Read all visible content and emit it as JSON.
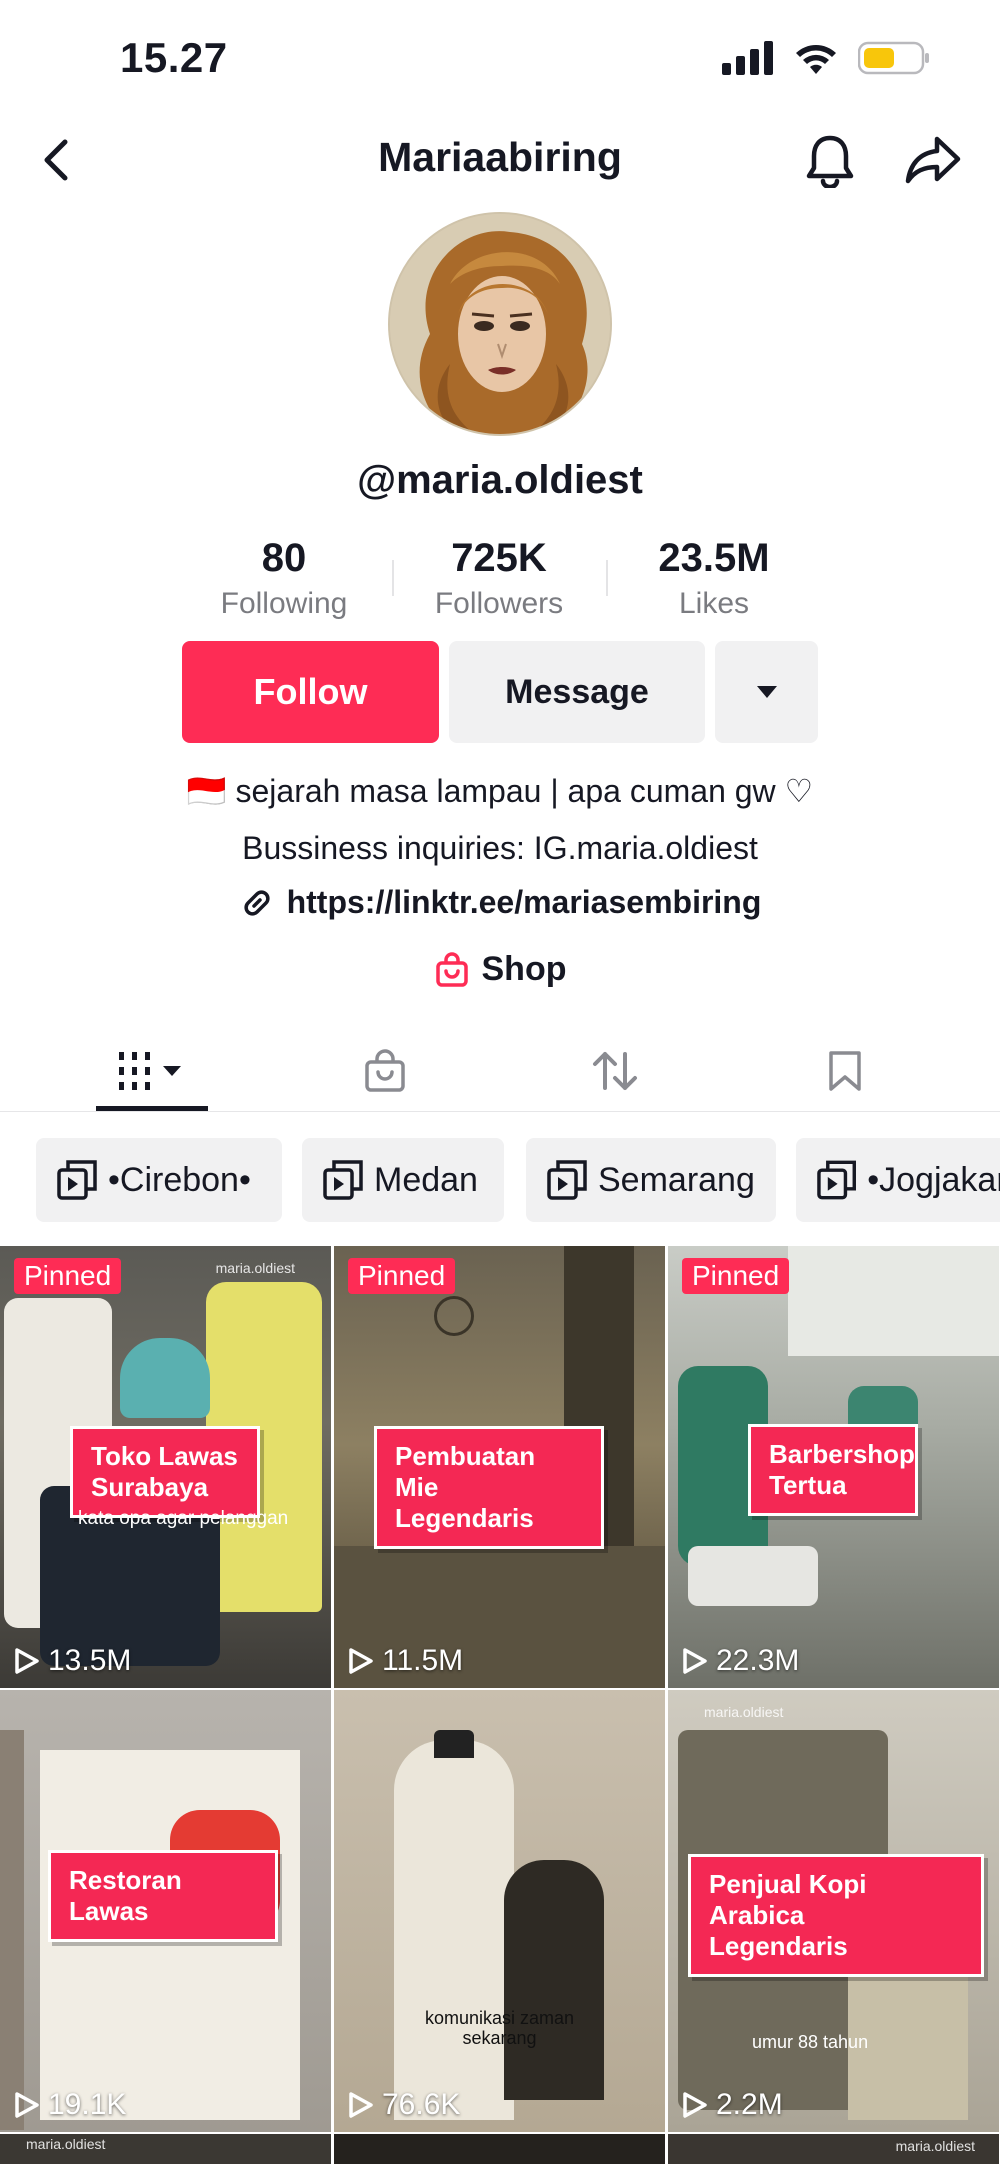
{
  "status_bar": {
    "time": "15.27"
  },
  "header": {
    "title": "Mariaabiring"
  },
  "profile": {
    "username": "@maria.oldiest",
    "stats": [
      {
        "value": "80",
        "label": "Following"
      },
      {
        "value": "725K",
        "label": "Followers"
      },
      {
        "value": "23.5M",
        "label": "Likes"
      }
    ],
    "follow_label": "Follow",
    "message_label": "Message",
    "bio_line1": "🇮🇩 sejarah masa lampau | apa cuman gw ♡",
    "bio_line2": "Bussiness inquiries: IG.maria.oldiest",
    "link": "https://linktr.ee/mariasembiring",
    "shop_label": "Shop"
  },
  "playlists": [
    "•Cirebon•",
    "Medan",
    "Semarang",
    "•Jogjakarta"
  ],
  "videos": [
    {
      "pinned": "Pinned",
      "title_line1": "Toko Lawas",
      "title_line2": "Surabaya",
      "views": "13.5M",
      "caption": "kata opa agar pelanggan",
      "watermark": "maria.oldiest"
    },
    {
      "pinned": "Pinned",
      "title_line1": "Pembuatan Mie",
      "title_line2": "Legendaris",
      "views": "11.5M",
      "caption": "",
      "watermark": ""
    },
    {
      "pinned": "Pinned",
      "title_line1": "Barbershop",
      "title_line2": "Tertua",
      "views": "22.3M",
      "caption": "",
      "watermark": ""
    },
    {
      "pinned": "",
      "title_line1": "Restoran Lawas",
      "title_line2": "",
      "views": "19.1K",
      "caption": "",
      "watermark": ""
    },
    {
      "pinned": "",
      "title_line1": "",
      "title_line2": "",
      "views": "76.6K",
      "caption": "komunikasi zaman sekarang",
      "watermark": ""
    },
    {
      "pinned": "",
      "title_line1": "Penjual Kopi Arabica",
      "title_line2": "Legendaris",
      "views": "2.2M",
      "caption": "umur 88 tahun",
      "watermark": "maria.oldiest"
    }
  ],
  "bottom_watermarks": [
    "maria.oldiest",
    "maria.oldiest"
  ],
  "colors": {
    "accent": "#fe2c55",
    "text": "#161823",
    "secondary_text": "#7a7b80",
    "button_bg": "#f1f1f2"
  },
  "icons": [
    "back-icon",
    "bell-icon",
    "share-icon",
    "caret-down-icon",
    "link-icon",
    "shop-bag-icon",
    "grid-icon",
    "bag-icon",
    "repost-icon",
    "bookmark-icon",
    "playlist-icon",
    "play-icon"
  ]
}
